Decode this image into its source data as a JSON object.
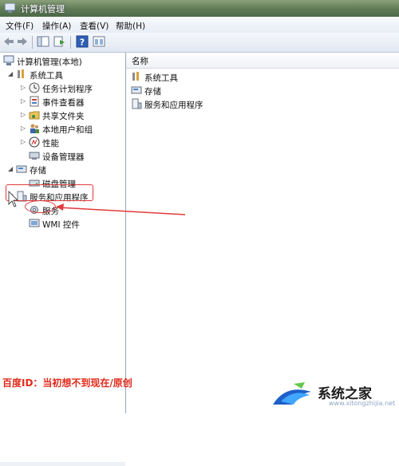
{
  "window": {
    "title": "计算机管理"
  },
  "menu": [
    "文件(F)",
    "操作(A)",
    "查看(V)",
    "帮助(H)"
  ],
  "toolbar": [
    "back-icon",
    "forward-icon",
    "show-hide-tree-icon",
    "export-list-icon",
    "help-icon",
    "properties-icon"
  ],
  "tree": {
    "root": "计算机管理(本地)",
    "system_tools": "系统工具",
    "task_scheduler": "任务计划程序",
    "event_viewer": "事件查看器",
    "shared_folders": "共享文件夹",
    "local_users": "本地用户和组",
    "performance": "性能",
    "device_manager": "设备管理器",
    "storage": "存储",
    "disk_management": "磁盘管理",
    "services_apps": "服务和应用程序",
    "services": "服务",
    "wmi": "WMI 控件"
  },
  "list": {
    "column_name": "名称",
    "items": [
      "系统工具",
      "存储",
      "服务和应用程序"
    ]
  },
  "watermark": {
    "caption": "百度ID：当初想不到现在/原创",
    "logo_text": "系统之家",
    "logo_url": "www.xitongzhijia.net"
  },
  "colors": {
    "annotation": "#e23a3a",
    "titlebar": "#5f7a55"
  }
}
